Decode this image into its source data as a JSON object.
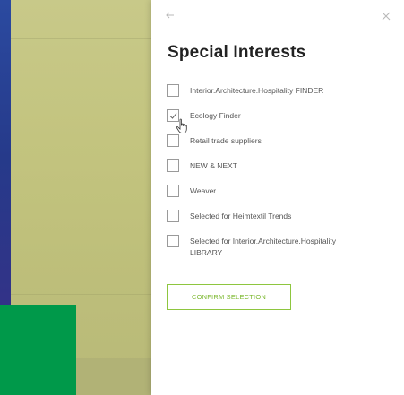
{
  "panel": {
    "title": "Special Interests",
    "back_icon": "arrow-left-icon",
    "close_icon": "close-icon",
    "options": [
      {
        "label": "Interior.Architecture.Hospitality FINDER",
        "checked": false
      },
      {
        "label": "Ecology Finder",
        "checked": true
      },
      {
        "label": "Retail trade suppliers",
        "checked": false
      },
      {
        "label": "NEW & NEXT",
        "checked": false
      },
      {
        "label": "Weaver",
        "checked": false
      },
      {
        "label": "Selected for Heimtextil Trends",
        "checked": false
      },
      {
        "label": "Selected for Interior.Architecture.Hospitality LIBRARY",
        "checked": false
      }
    ],
    "confirm_label": "CONFIRM SELECTION"
  },
  "colors": {
    "accent_green": "#8ec63f",
    "brand_green_block": "#00994a",
    "backdrop_olive": "#c4c581",
    "left_edge_blue": "#2b4aa0"
  }
}
